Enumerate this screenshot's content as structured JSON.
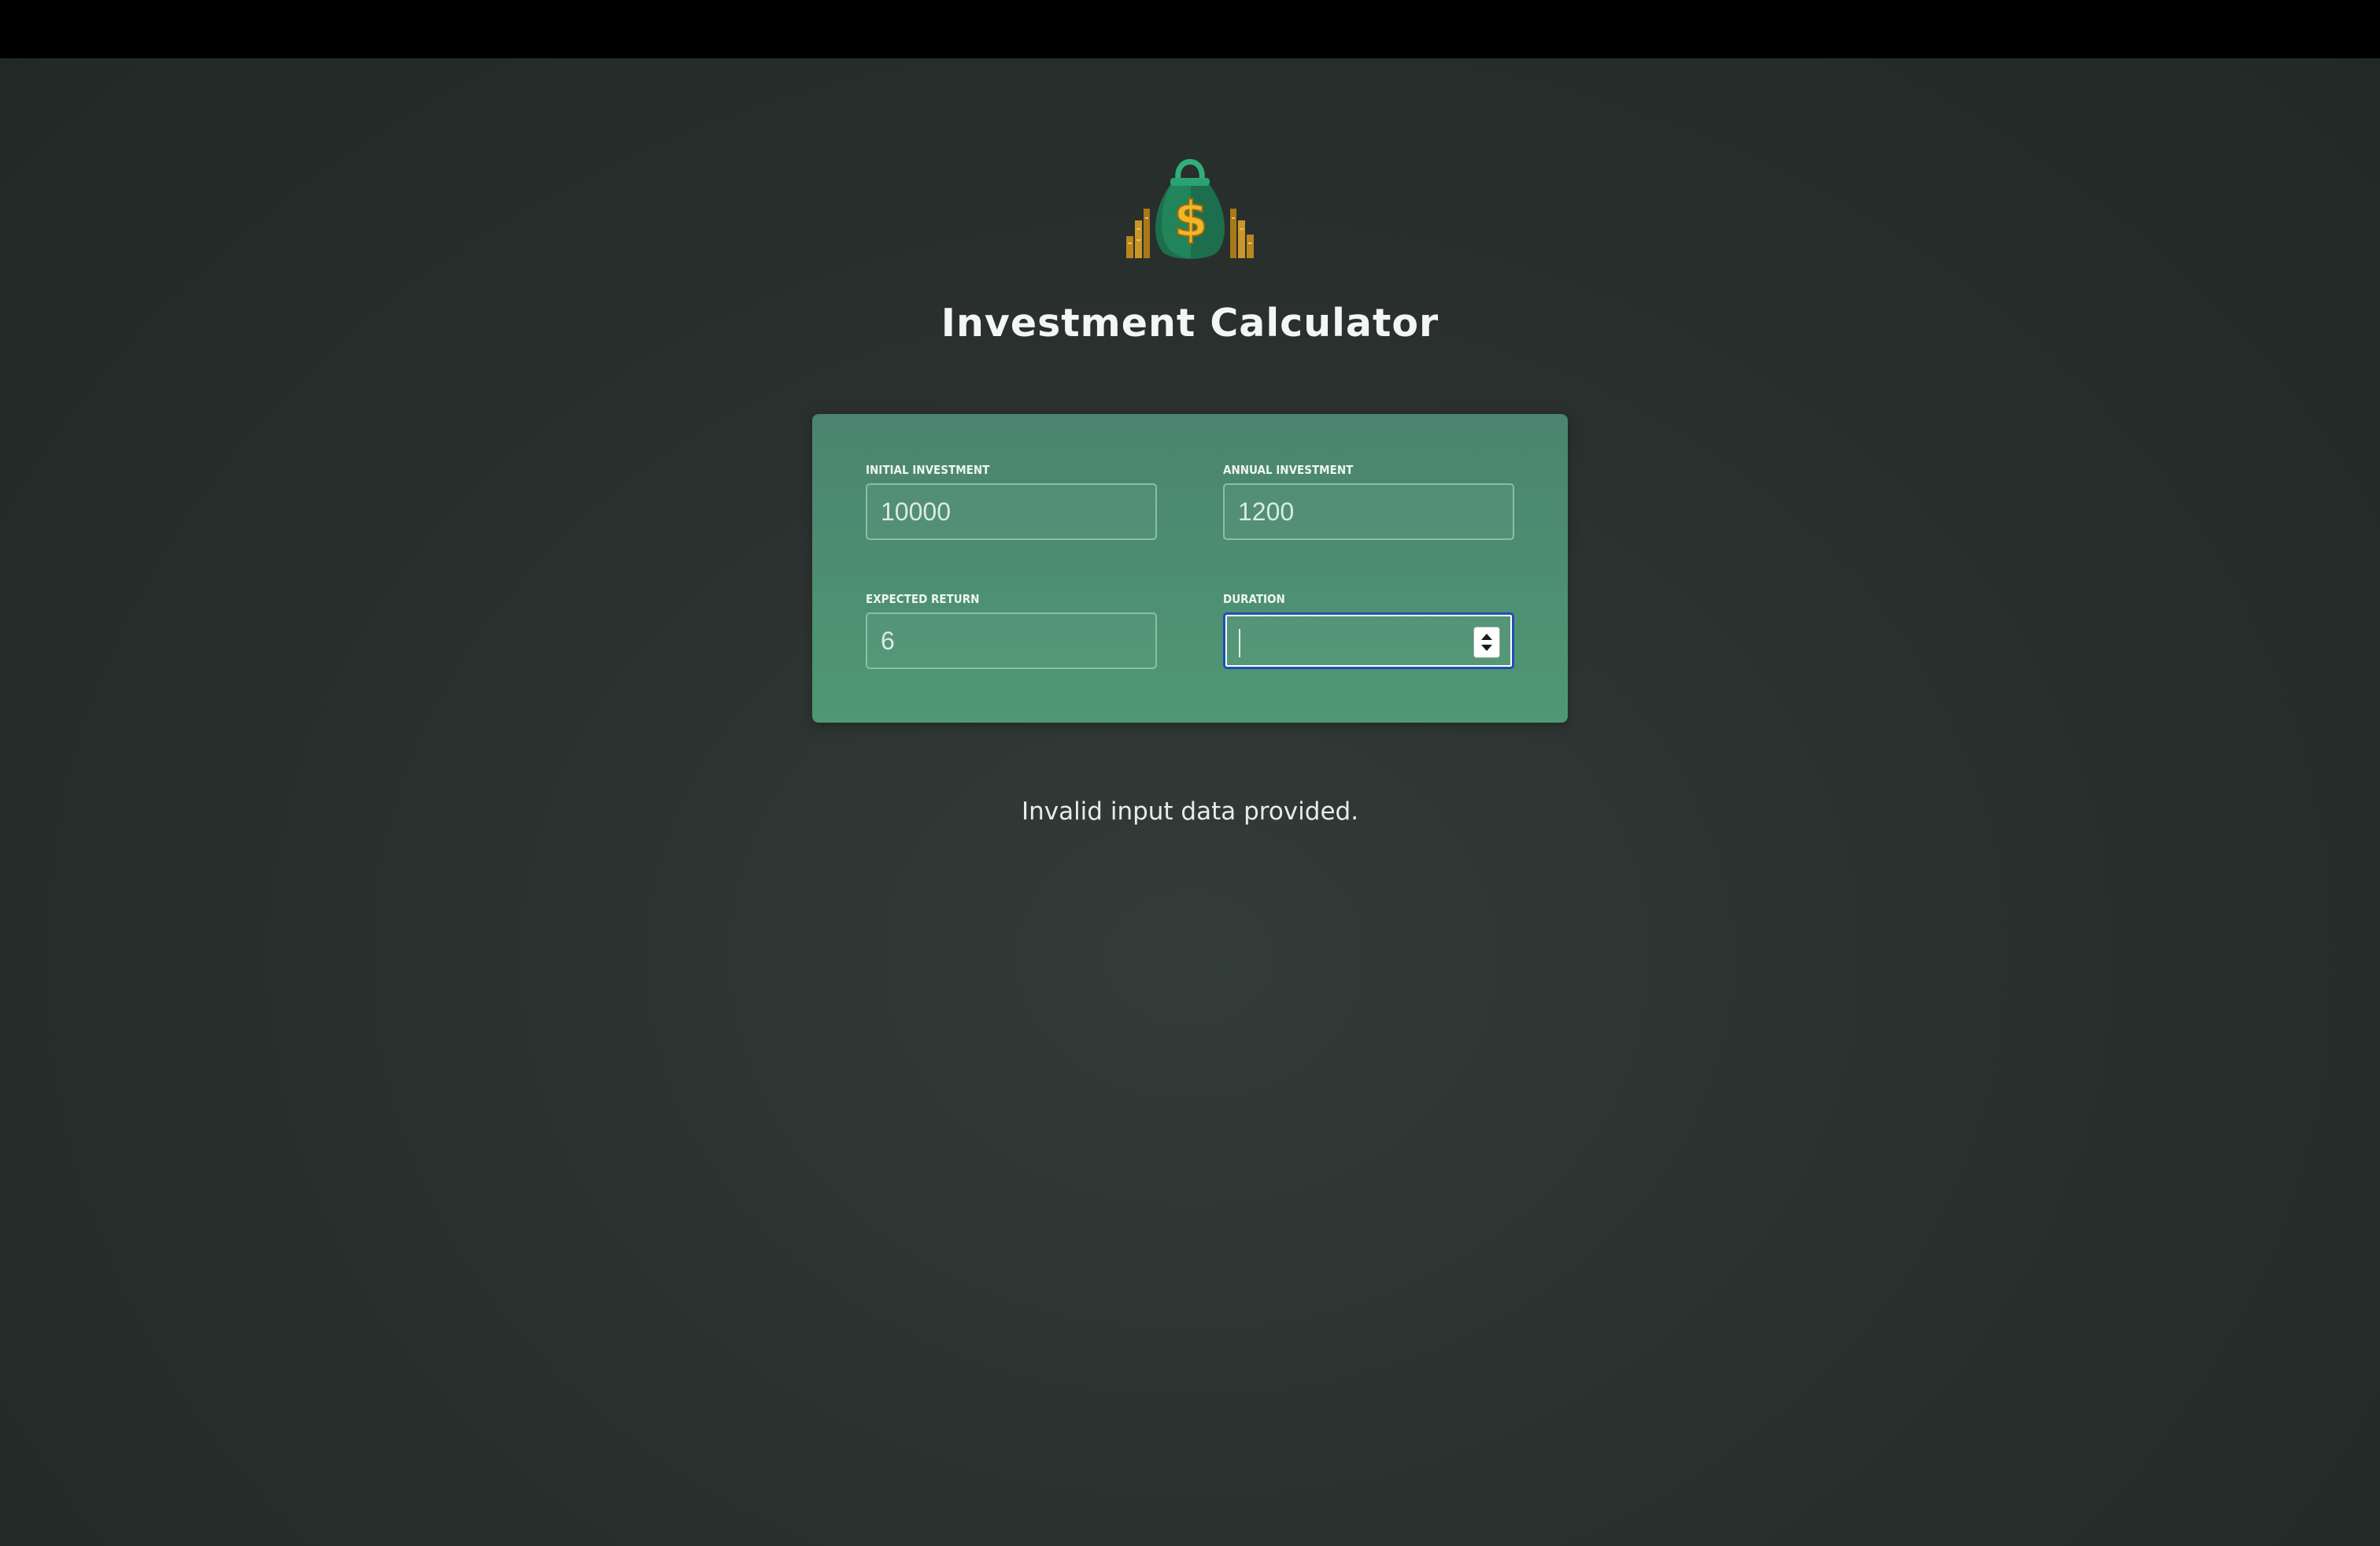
{
  "app": {
    "title": "Investment Calculator",
    "logo_icon": "money-bag-dollar-icon"
  },
  "form": {
    "initial_investment": {
      "label": "Initial Investment",
      "value": "10000"
    },
    "annual_investment": {
      "label": "Annual Investment",
      "value": "1200"
    },
    "expected_return": {
      "label": "Expected Return",
      "value": "6"
    },
    "duration": {
      "label": "Duration",
      "value": "",
      "focused": true
    }
  },
  "status": {
    "message": "Invalid input data provided."
  },
  "colors": {
    "panel_top": "#4b8470",
    "panel_bottom": "#4f9873",
    "focus_ring": "#1f4fb8",
    "background": "#2a302e"
  }
}
